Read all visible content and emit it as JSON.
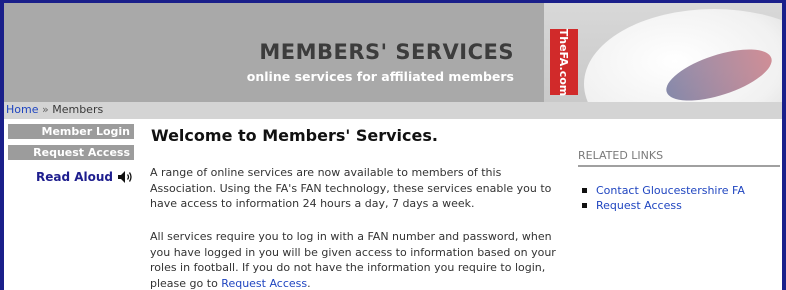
{
  "banner": {
    "title": "MEMBERS' SERVICES",
    "subtitle": "online services for affiliated members",
    "badge_text": "TheFA.com"
  },
  "breadcrumb": {
    "home": "Home",
    "separator": "»",
    "current": "Members"
  },
  "sidebar": {
    "items": [
      {
        "label": "Member Login"
      },
      {
        "label": "Request Access"
      }
    ],
    "read_aloud": "Read Aloud",
    "read_aloud_icon": "speaker-icon"
  },
  "main": {
    "title": "Welcome to Members' Services.",
    "paragraph1": "A range of online services are now available to members of this Association. Using the FA's FAN technology, these services enable you to have access to information 24 hours a day, 7 days a week.",
    "paragraph2_text": "All services require you to log in with a FAN number and password, when you have logged in you will be given access to information based on your roles in football. If you do not have the information you require to login, please go to",
    "paragraph2_link": "Request Access",
    "paragraph2_end": "."
  },
  "related": {
    "heading": "RELATED LINKS",
    "links": [
      {
        "label": "Contact Gloucestershire FA"
      },
      {
        "label": "Request Access"
      }
    ]
  },
  "colors": {
    "frame": "#1a1f8a",
    "banner_bg": "#a9a9a9",
    "link": "#1f45c0",
    "sidebar_bg": "#9c9c9c",
    "fa_red": "#d12a2a"
  }
}
